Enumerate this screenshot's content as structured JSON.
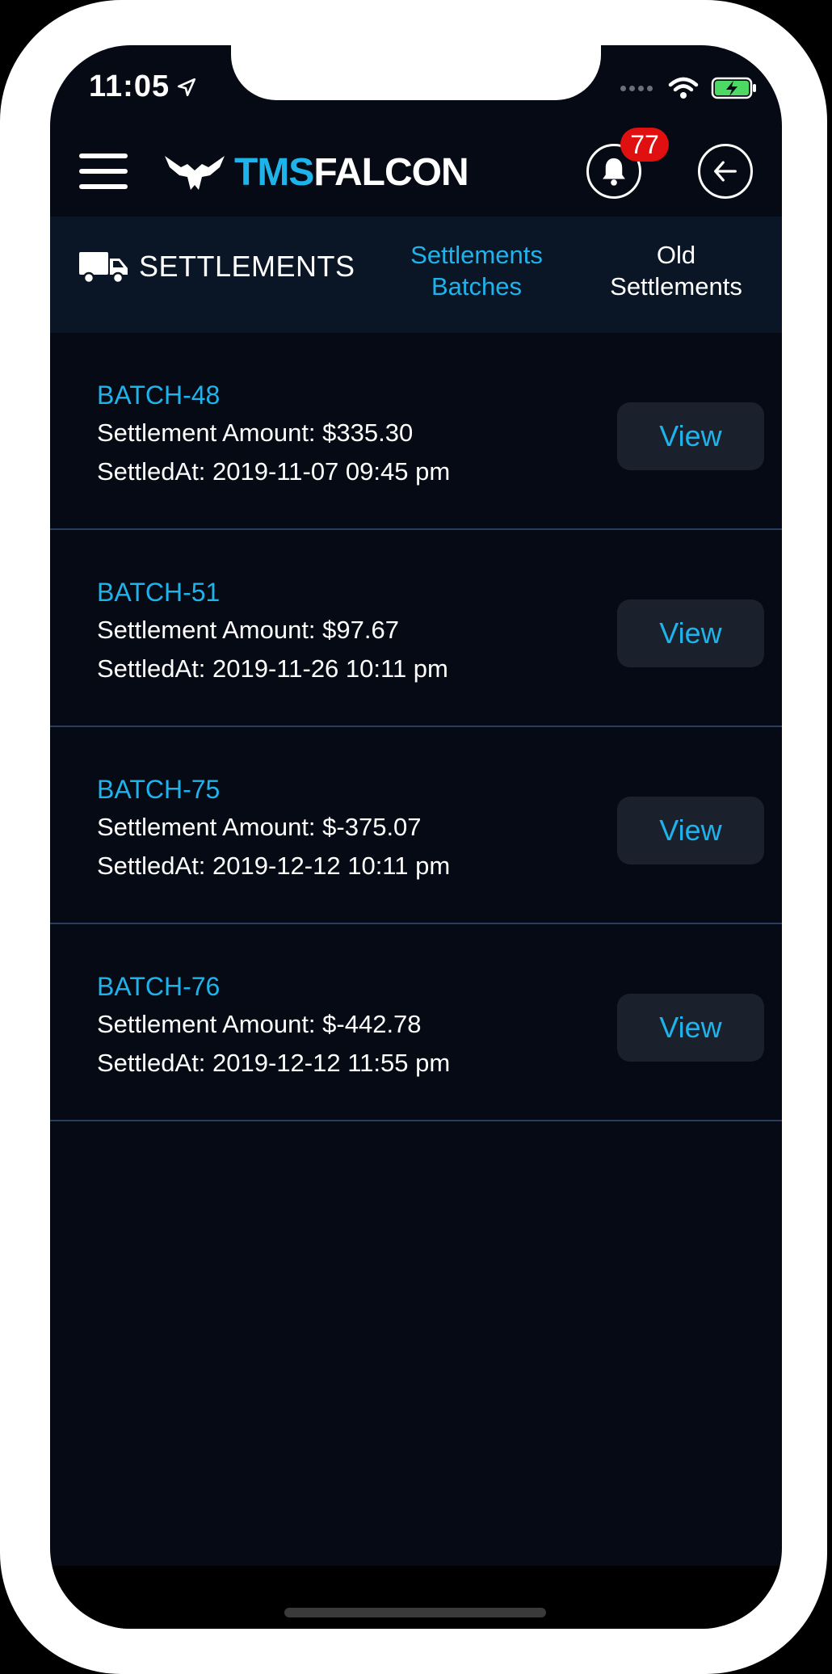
{
  "status_bar": {
    "time": "11:05"
  },
  "header": {
    "logo": {
      "tms": "TMS",
      "falcon": "FALCON"
    },
    "notification_count": "77"
  },
  "tabs": {
    "section_title": "SETTLEMENTS",
    "batches_label_line1": "Settlements",
    "batches_label_line2": "Batches",
    "old_label_line1": "Old",
    "old_label_line2": "Settlements"
  },
  "settlements": [
    {
      "batch": "BATCH-48",
      "amount": "Settlement Amount: $335.30",
      "settled_at": "SettledAt: 2019-11-07 09:45 pm",
      "button": "View"
    },
    {
      "batch": "BATCH-51",
      "amount": "Settlement Amount: $97.67",
      "settled_at": "SettledAt: 2019-11-26 10:11 pm",
      "button": "View"
    },
    {
      "batch": "BATCH-75",
      "amount": "Settlement Amount: $-375.07",
      "settled_at": "SettledAt: 2019-12-12 10:11 pm",
      "button": "View"
    },
    {
      "batch": "BATCH-76",
      "amount": "Settlement Amount: $-442.78",
      "settled_at": "SettledAt: 2019-12-12 11:55 pm",
      "button": "View"
    }
  ],
  "colors": {
    "accent": "#1fb3ec",
    "background": "#050a14",
    "tabbar": "#0a1626",
    "badge": "#e01010"
  }
}
